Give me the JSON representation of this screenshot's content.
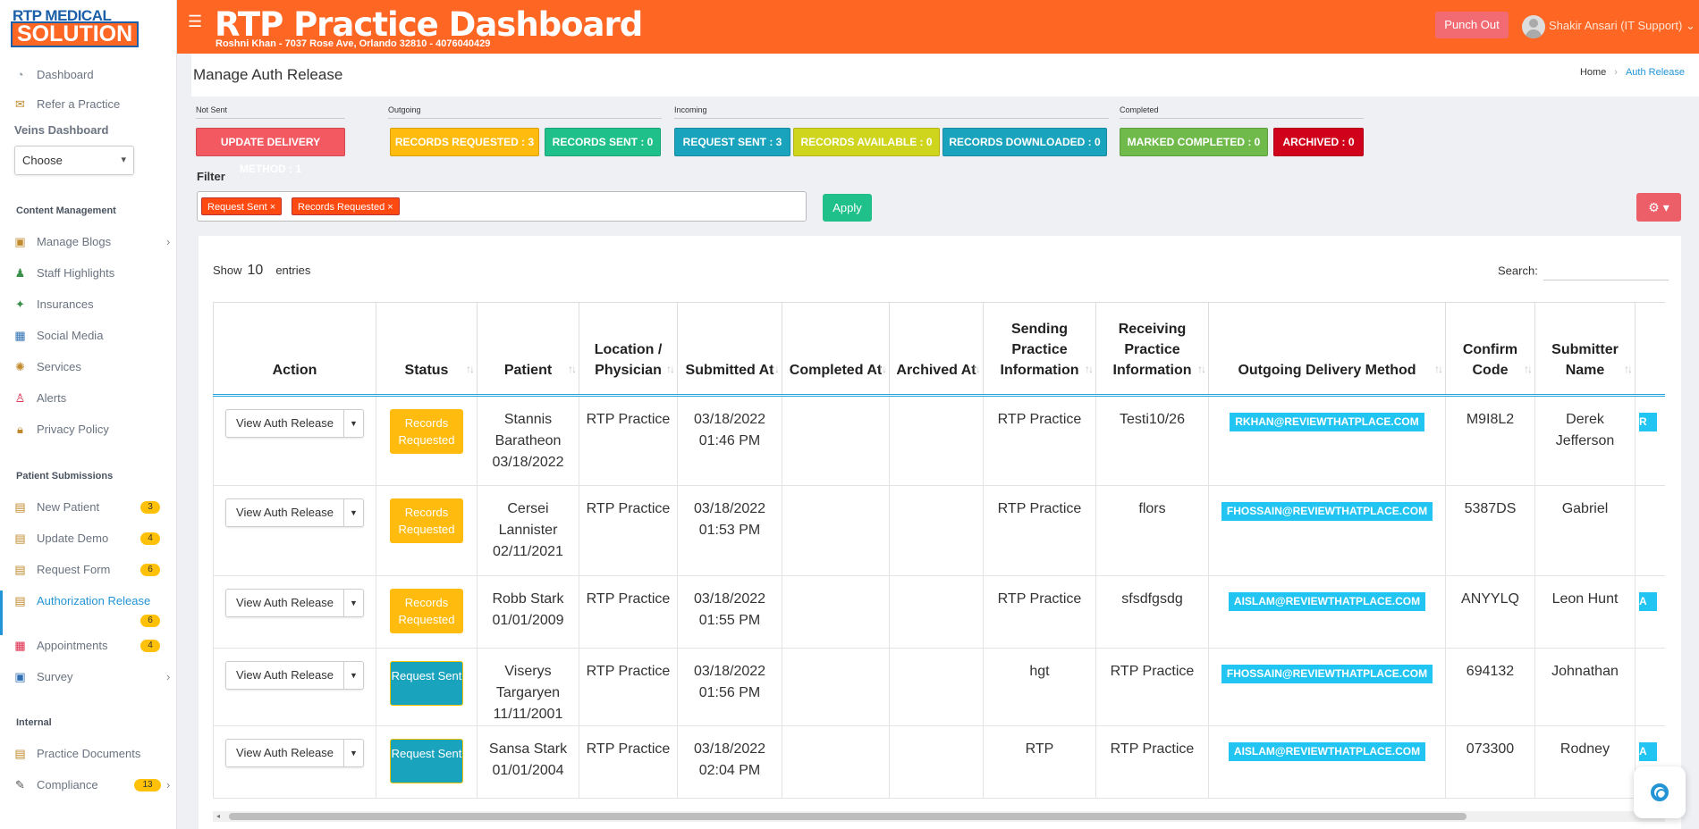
{
  "header": {
    "logo_top": "RTP MEDICAL",
    "logo_bottom": "SOLUTION",
    "title": "RTP Practice Dashboard",
    "subtitle": "Roshni Khan - 7037 Rose Ave, Orlando 32810 - 4076040429",
    "punch_out": "Punch Out",
    "user": "Shakir Ansari (IT Support)",
    "accent_color": "#fe6624"
  },
  "sidebar": {
    "top_items": [
      {
        "label": "Dashboard",
        "icon": "dashboard-icon"
      },
      {
        "label": "Refer a Practice",
        "icon": "refer-icon"
      }
    ],
    "veins_label": "Veins Dashboard",
    "choose": "Choose",
    "content_management": "Content Management",
    "cm_items": [
      {
        "label": "Manage Blogs",
        "icon": "blog-icon",
        "chevron": true
      },
      {
        "label": "Staff Highlights",
        "icon": "staff-icon"
      },
      {
        "label": "Insurances",
        "icon": "insurance-icon"
      },
      {
        "label": "Social Media",
        "icon": "social-icon"
      },
      {
        "label": "Services",
        "icon": "services-icon"
      },
      {
        "label": "Alerts",
        "icon": "alerts-icon"
      },
      {
        "label": "Privacy Policy",
        "icon": "privacy-icon"
      }
    ],
    "patient_submissions": "Patient Submissions",
    "ps_items": [
      {
        "label": "New Patient",
        "badge": "3",
        "icon": "new-patient-icon"
      },
      {
        "label": "Update Demo",
        "badge": "4",
        "icon": "update-demo-icon"
      },
      {
        "label": "Request Form",
        "badge": "6",
        "icon": "request-form-icon"
      },
      {
        "label": "Authorization Release",
        "badge": "6",
        "icon": "authorization-icon"
      },
      {
        "label": "Appointments",
        "badge": "4",
        "icon": "appointments-icon"
      },
      {
        "label": "Survey",
        "icon": "survey-icon"
      }
    ],
    "internal": "Internal",
    "int_items": [
      {
        "label": "Practice Documents",
        "icon": "documents-icon"
      },
      {
        "label": "Compliance",
        "badge": "13",
        "icon": "compliance-icon"
      }
    ]
  },
  "page": {
    "title": "Manage Auth Release",
    "breadcrumb_home": "Home",
    "breadcrumb_current": "Auth Release"
  },
  "groups": {
    "not_sent": "Not Sent",
    "outgoing": "Outgoing",
    "incoming": "Incoming",
    "completed": "Completed"
  },
  "pills": {
    "update_delivery": "UPDATE DELIVERY METHOD : 1",
    "records_requested": "RECORDS REQUESTED : 3",
    "records_sent": "RECORDS SENT : 0",
    "request_sent": "REQUEST SENT : 3",
    "records_available": "RECORDS AVAILABLE : 0",
    "records_downloaded": "RECORDS DOWNLOADED : 0",
    "marked_completed": "MARKED COMPLETED : 0",
    "archived": "ARCHIVED : 0"
  },
  "filter": {
    "label": "Filter",
    "tags": [
      "Request Sent",
      "Records Requested"
    ],
    "apply": "Apply"
  },
  "table": {
    "show": "Show",
    "entries_count": "10",
    "entries": "entries",
    "search": "Search:",
    "columns": [
      "Action",
      "Status",
      "Patient",
      "Location / Physician",
      "Submitted At",
      "Completed At",
      "Archived At",
      "Sending Practice Information",
      "Receiving Practice Information",
      "Outgoing Delivery Method",
      "Confirm Code",
      "Submitter Name"
    ],
    "action_label": "View Auth Release",
    "rows": [
      {
        "status": "Records Requested",
        "status_type": "req",
        "patient": "Stannis Baratheon 03/18/2022",
        "location": "RTP Practice",
        "submitted": "03/18/2022 01:46 PM",
        "completed": "",
        "archived": "",
        "sending": "RTP Practice",
        "receiving": "Testi10/26",
        "delivery": "RKHAN@REVIEWTHATPLACE.COM",
        "code": "M9I8L2",
        "submitter": "Derek Jefferson",
        "extra": "R"
      },
      {
        "status": "Records Requested",
        "status_type": "req",
        "patient": "Cersei Lannister 02/11/2021",
        "location": "RTP Practice",
        "submitted": "03/18/2022 01:53 PM",
        "completed": "",
        "archived": "",
        "sending": "RTP Practice",
        "receiving": "flors",
        "delivery": "FHOSSAIN@REVIEWTHATPLACE.COM",
        "code": "5387DS",
        "submitter": "Gabriel",
        "extra": ""
      },
      {
        "status": "Records Requested",
        "status_type": "req",
        "patient": "Robb Stark 01/01/2009",
        "location": "RTP Practice",
        "submitted": "03/18/2022 01:55 PM",
        "completed": "",
        "archived": "",
        "sending": "RTP Practice",
        "receiving": "sfsdfgsdg",
        "delivery": "AISLAM@REVIEWTHATPLACE.COM",
        "code": "ANYYLQ",
        "submitter": "Leon Hunt",
        "extra": "A"
      },
      {
        "status": "Request Sent",
        "status_type": "snt",
        "patient": "Viserys Targaryen 11/11/2001",
        "location": "RTP Practice",
        "submitted": "03/18/2022 01:56 PM",
        "completed": "",
        "archived": "",
        "sending": "hgt",
        "receiving": "RTP Practice",
        "delivery": "FHOSSAIN@REVIEWTHATPLACE.COM",
        "code": "694132",
        "submitter": "Johnathan",
        "extra": ""
      },
      {
        "status": "Request Sent",
        "status_type": "snt",
        "patient": "Sansa Stark 01/01/2004",
        "location": "RTP Practice",
        "submitted": "03/18/2022 02:04 PM",
        "completed": "",
        "archived": "",
        "sending": "RTP",
        "receiving": "RTP Practice",
        "delivery": "AISLAM@REVIEWTHATPLACE.COM",
        "code": "073300",
        "submitter": "Rodney",
        "extra": "A"
      }
    ]
  }
}
